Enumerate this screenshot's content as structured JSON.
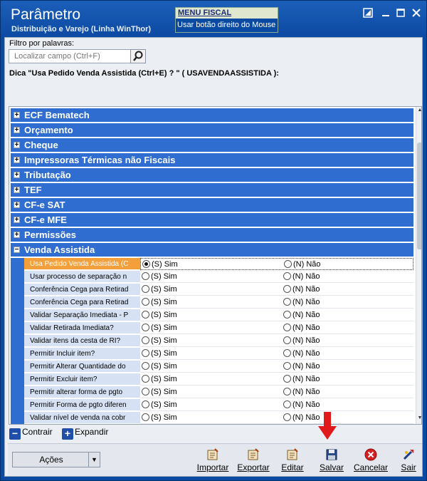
{
  "window": {
    "title": "Parâmetro",
    "subtitle": "Distribuição e Varejo (Linha WinThor)",
    "menu_fiscal": {
      "title": "MENU FISCAL",
      "text": "Usar botão direito do Mouse a"
    }
  },
  "filter": {
    "label": "Filtro por palavras:",
    "placeholder": "Localizar campo (Ctrl+F)"
  },
  "hint": "Dica \"Usa Pedido Venda Assistida (Ctrl+E) ? \" ( USAVENDAASSISTIDA ):",
  "groups": [
    {
      "label": "ECF Bematech",
      "sign": "+"
    },
    {
      "label": "Orçamento",
      "sign": "+"
    },
    {
      "label": "Cheque",
      "sign": "+"
    },
    {
      "label": "Impressoras Térmicas não Fiscais",
      "sign": "+"
    },
    {
      "label": "Tributação",
      "sign": "+"
    },
    {
      "label": "TEF",
      "sign": "+"
    },
    {
      "label": "CF-e SAT",
      "sign": "+"
    },
    {
      "label": "CF-e MFE",
      "sign": "+"
    },
    {
      "label": "Permissões",
      "sign": "+"
    },
    {
      "label": "Venda Assistida",
      "sign": "−"
    }
  ],
  "option_labels": {
    "yes": "(S) Sim",
    "no": "(N) Não"
  },
  "params": [
    {
      "label": "Usa Pedido Venda Assistida (C",
      "value": "S"
    },
    {
      "label": "Usar processo de separação n",
      "value": ""
    },
    {
      "label": "Conferência Cega para Retirad",
      "value": ""
    },
    {
      "label": "Conferência Cega para Retirad",
      "value": ""
    },
    {
      "label": "Validar Separação Imediata - P",
      "value": ""
    },
    {
      "label": "Validar Retirada Imediata?",
      "value": ""
    },
    {
      "label": "Validar itens da cesta de RI?",
      "value": ""
    },
    {
      "label": "Permitir Incluir item?",
      "value": ""
    },
    {
      "label": "Permitir Alterar Quantidade do",
      "value": ""
    },
    {
      "label": "Permitir Excluir item?",
      "value": ""
    },
    {
      "label": "Permitir alterar forma de pgto",
      "value": ""
    },
    {
      "label": "Permitir Forma de pgto diferen",
      "value": ""
    },
    {
      "label": "Validar nível de venda na cobr",
      "value": ""
    }
  ],
  "expand_bar": {
    "collapse": "Contrair",
    "expand": "Expandir"
  },
  "toolbar": {
    "acoes": "Ações",
    "buttons": [
      "Importar",
      "Exportar",
      "Editar",
      "Salvar",
      "Cancelar",
      "Sair"
    ]
  },
  "colors": {
    "title_bg": "#0d4aa4",
    "group_bg": "#2f6dd0",
    "selected_row": "#f3a03c",
    "annotation_arrow": "#e01a1a"
  }
}
